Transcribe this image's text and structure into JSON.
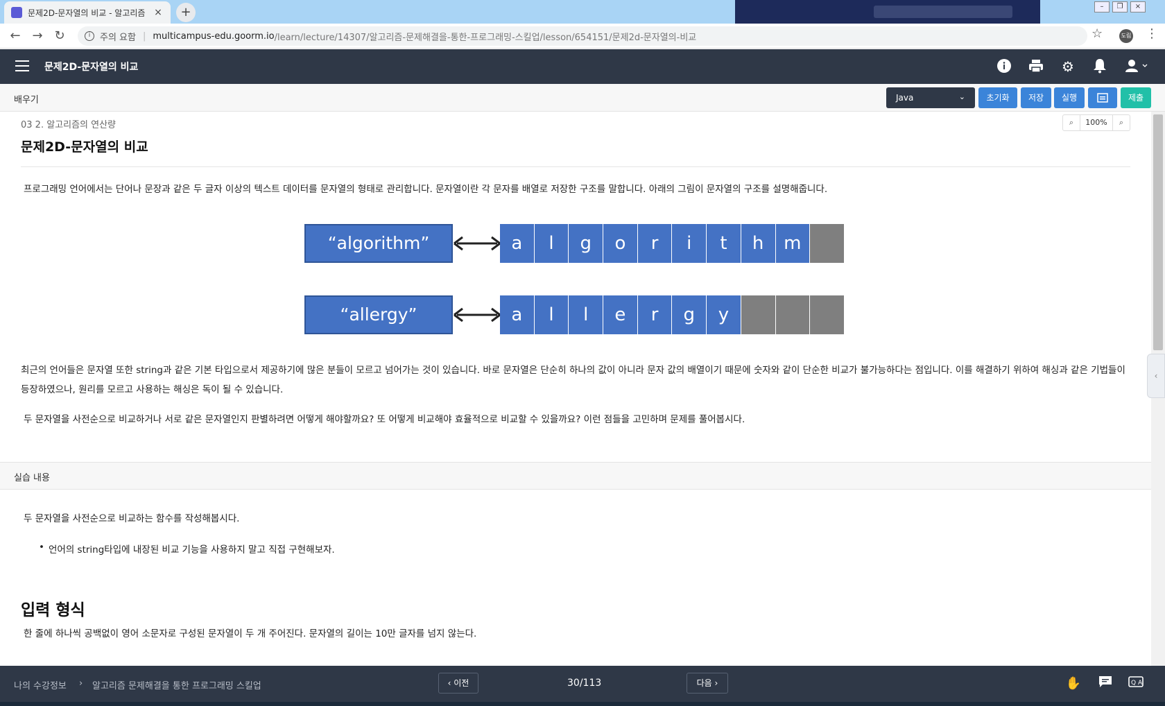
{
  "browser": {
    "tab_title": "문제2D-문자열의 비교 - 알고리즘",
    "tab_close": "×",
    "new_tab": "+",
    "insecure_label": "주의 요함",
    "url_host": "multicampus-edu.goorm.io",
    "url_path": "/learn/lecture/14307/알고리즘-문제해결을-통한-프로그래밍-스킬업/lesson/654151/문제2d-문자열의-비교",
    "profile_label": "도림"
  },
  "header": {
    "title": "문제2D-문자열의 비교"
  },
  "toolbar": {
    "learn_label": "배우기",
    "language": "Java",
    "reset_label": "초기화",
    "save_label": "저장",
    "run_label": "실행",
    "submit_label": "제출"
  },
  "content": {
    "breadcrumb": "03 2. 알고리즘의 연산량",
    "zoom": "100%",
    "title": "문제2D-문자열의 비교",
    "intro": "프로그래밍 언어에서는 단어나 문장과 같은 두 글자 이상의 텍스트 데이터를 문자열의 형태로 관리합니다. 문자열이란 각 문자를 배열로 저장한 구조를 말합니다. 아래의 그림이 문자열의 구조를 설명해줍니다.",
    "diagram": {
      "word1": "“algorithm”",
      "cells1": [
        "a",
        "l",
        "g",
        "o",
        "r",
        "i",
        "t",
        "h",
        "m",
        ""
      ],
      "word2": "“allergy”",
      "cells2": [
        "a",
        "l",
        "l",
        "e",
        "r",
        "g",
        "y",
        "",
        "",
        ""
      ]
    },
    "para2": "최근의 언어들은 문자열 또한 string과 같은 기본 타입으로서 제공하기에 많은 분들이 모르고 넘어가는 것이 있습니다. 바로 문자열은 단순히 하나의 값이 아니라 문자 값의 배열이기 때문에 숫자와 같이 단순한 비교가 불가능하다는 점입니다. 이를 해결하기 위하여 해싱과 같은 기법들이 등장하였으나, 원리를 모르고 사용하는 해싱은 독이 될 수 있습니다.",
    "para3": "두 문자열을 사전순으로 비교하거나 서로 같은 문자열인지 판별하려면 어떻게 해야할까요? 또 어떻게 비교해야 효율적으로 비교할 수 있을까요? 이런 점들을 고민하며 문제를 풀어봅시다.",
    "section_label": "실습 내용",
    "task": "두 문자열을 사전순으로 비교하는 함수를 작성해봅시다.",
    "task_bullet": "언어의 string타입에 내장된 비교 기능을 사용하지 말고 직접 구현해보자.",
    "input_heading": "입력 형식",
    "input_desc": "한 줄에 하나씩 공백없이 영어 소문자로 구성된 문자열이 두 개 주어진다. 문자열의 길이는 10만 글자를 넘지 않는다."
  },
  "footer": {
    "crumb1": "나의 수강정보",
    "crumb_sep": "›",
    "crumb2": "알고리즘 문제해결을 통한 프로그래밍 스킬업",
    "prev_label": "‹ 이전",
    "page": "30/113",
    "next_label": "다음 ›"
  }
}
